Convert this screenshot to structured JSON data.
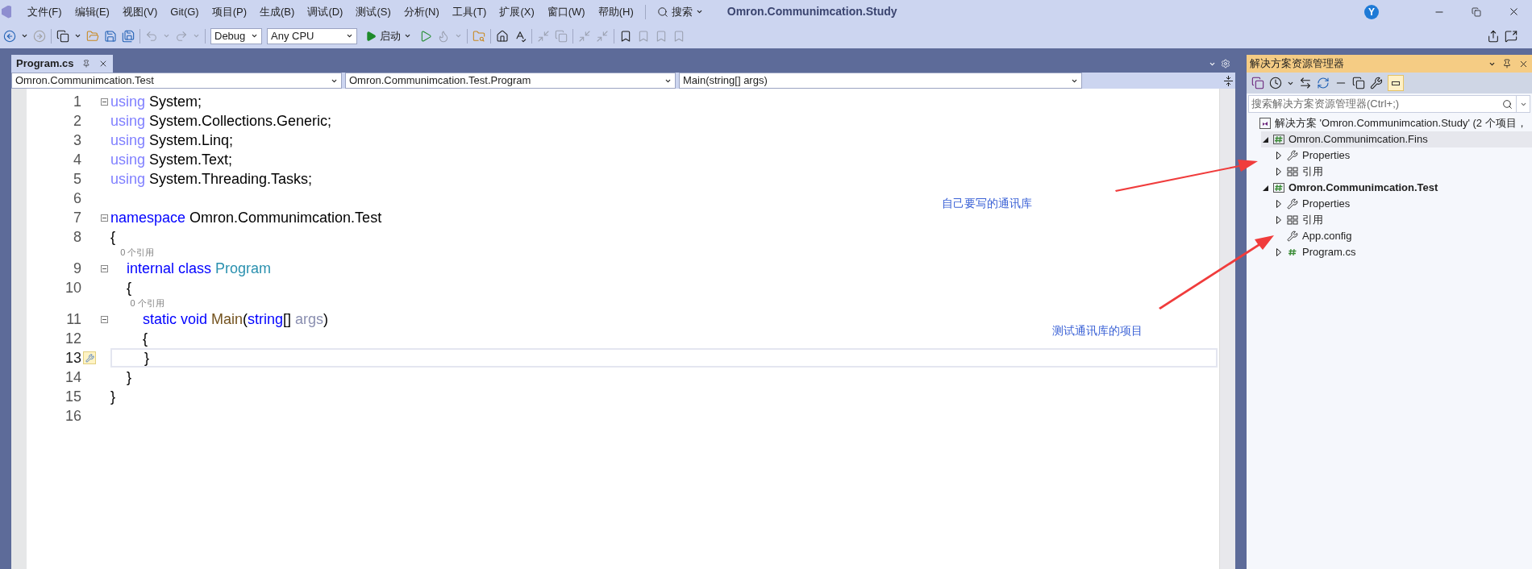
{
  "window": {
    "title": "Omron.Communimcation.Study",
    "avatar": "Y"
  },
  "menu": [
    "文件(F)",
    "编辑(E)",
    "视图(V)",
    "Git(G)",
    "项目(P)",
    "生成(B)",
    "调试(D)",
    "测试(S)",
    "分析(N)",
    "工具(T)",
    "扩展(X)",
    "窗口(W)",
    "帮助(H)"
  ],
  "search": "搜索",
  "toolbar": {
    "configuration": "Debug",
    "platform": "Any CPU",
    "start": "启动"
  },
  "tabs": [
    {
      "label": "Program.cs",
      "selected": true
    }
  ],
  "navigation": [
    "Omron.Communimcation.Test",
    "Omron.Communimcation.Test.Program",
    "Main(string[] args)"
  ],
  "editor": {
    "lines": [
      {
        "number": "1",
        "fold": true,
        "current": false,
        "tokens": [
          {
            "text": "using",
            "kind": "using"
          },
          {
            "text": " System;",
            "kind": "plain"
          }
        ]
      },
      {
        "number": "2",
        "fold": false,
        "current": false,
        "tokens": [
          {
            "text": "using",
            "kind": "using"
          },
          {
            "text": " System.Collections.Generic;",
            "kind": "plain"
          }
        ]
      },
      {
        "number": "3",
        "fold": false,
        "current": false,
        "tokens": [
          {
            "text": "using",
            "kind": "using"
          },
          {
            "text": " System.Linq;",
            "kind": "plain"
          }
        ]
      },
      {
        "number": "4",
        "fold": false,
        "current": false,
        "tokens": [
          {
            "text": "using",
            "kind": "using"
          },
          {
            "text": " System.Text;",
            "kind": "plain"
          }
        ]
      },
      {
        "number": "5",
        "fold": false,
        "current": false,
        "tokens": [
          {
            "text": "using",
            "kind": "using"
          },
          {
            "text": " System.Threading.Tasks;",
            "kind": "plain"
          }
        ]
      },
      {
        "number": "6",
        "fold": false,
        "current": false
      },
      {
        "number": "7",
        "fold": true,
        "current": false,
        "tokens": [
          {
            "text": "namespace",
            "kind": "keyword"
          },
          {
            "text": " Omron.Communimcation.Test",
            "kind": "plain"
          }
        ]
      },
      {
        "number": "8",
        "fold": false,
        "current": false,
        "tokens": [
          {
            "text": "{",
            "kind": "plain"
          }
        ]
      },
      {
        "number": "9",
        "fold": true,
        "current": false,
        "codelens": "0 个引用",
        "tokens": [
          {
            "text": "    internal class",
            "kind": "keyword"
          },
          {
            "text": " Program",
            "kind": "type"
          }
        ]
      },
      {
        "number": "10",
        "fold": false,
        "current": false,
        "tokens": [
          {
            "text": "    {",
            "kind": "plain"
          }
        ]
      },
      {
        "number": "11",
        "fold": true,
        "current": false,
        "codelens": "0 个引用",
        "tokens": [
          {
            "text": "        static void",
            "kind": "keyword"
          },
          {
            "text": " Main",
            "kind": "method"
          },
          {
            "text": "(",
            "kind": "plain"
          },
          {
            "text": "string",
            "kind": "keyword"
          },
          {
            "text": "[] ",
            "kind": "plain"
          },
          {
            "text": "args",
            "kind": "unused"
          },
          {
            "text": ")",
            "kind": "plain"
          }
        ]
      },
      {
        "number": "12",
        "fold": false,
        "current": false,
        "tokens": [
          {
            "text": "        {",
            "kind": "plain"
          }
        ]
      },
      {
        "number": "13",
        "fold": false,
        "current": true,
        "tokens": [
          {
            "text": "        }",
            "kind": "plain"
          }
        ]
      },
      {
        "number": "14",
        "fold": false,
        "current": false,
        "tokens": [
          {
            "text": "    }",
            "kind": "plain"
          }
        ]
      },
      {
        "number": "15",
        "fold": false,
        "current": false,
        "tokens": [
          {
            "text": "}",
            "kind": "plain"
          }
        ]
      },
      {
        "number": "16",
        "fold": false,
        "current": false
      }
    ]
  },
  "solution_explorer": {
    "title": "解决方案资源管理器",
    "search_placeholder": "搜索解决方案资源管理器(Ctrl+;)",
    "tree": [
      {
        "kind": "solution",
        "label": "解决方案 'Omron.Communimcation.Study' (2 个项目，",
        "selected": false,
        "children": [
          {
            "kind": "project",
            "label": "Omron.Communimcation.Fins",
            "expanded": true,
            "startup": false,
            "selected": true,
            "children": [
              {
                "kind": "properties",
                "label": "Properties",
                "expanded": false,
                "selected": false
              },
              {
                "kind": "references",
                "label": "引用",
                "expanded": false,
                "selected": false
              }
            ]
          },
          {
            "kind": "project",
            "label": "Omron.Communimcation.Test",
            "expanded": true,
            "startup": true,
            "selected": false,
            "children": [
              {
                "kind": "properties",
                "label": "Properties",
                "expanded": false,
                "selected": false
              },
              {
                "kind": "references",
                "label": "引用",
                "expanded": false,
                "selected": false
              },
              {
                "kind": "config",
                "label": "App.config",
                "selected": false
              },
              {
                "kind": "csharp",
                "label": "Program.cs",
                "expanded": false,
                "selected": false
              }
            ]
          }
        ]
      }
    ]
  },
  "annotations": [
    {
      "text": "自己要写的通讯库"
    },
    {
      "text": "测试通讯库的项目"
    }
  ]
}
